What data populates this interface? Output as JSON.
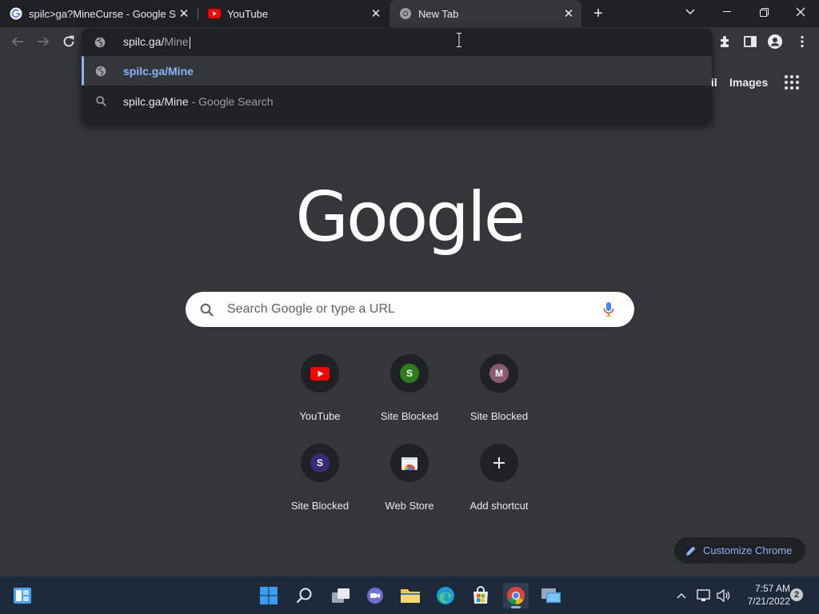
{
  "tabs": [
    {
      "title": "spilc>ga?MineCurse - Google Se",
      "icon": "google-g-icon"
    },
    {
      "title": "YouTube",
      "icon": "youtube-icon"
    },
    {
      "title": "New Tab",
      "icon": "chrome-icon",
      "active": true
    }
  ],
  "omnibox": {
    "typed": "spilc.ga/",
    "autocomplete": "Mine",
    "suggestions": [
      {
        "text": "spilc.ga/Mine",
        "suffix": "",
        "icon": "globe-icon",
        "selected": true
      },
      {
        "text": "spilc.ga/Mine",
        "suffix": " - Google Search",
        "icon": "search-icon",
        "selected": false
      }
    ]
  },
  "header": {
    "gmail_partial": "il",
    "images": "Images"
  },
  "logo": "Google",
  "search": {
    "placeholder": "Search Google or type a URL"
  },
  "shortcuts": [
    {
      "label": "YouTube",
      "icon": "youtube-icon"
    },
    {
      "label": "Site Blocked",
      "letter": "S",
      "color": "#2e7d1a"
    },
    {
      "label": "Site Blocked",
      "letter": "M",
      "color": "#8a5a72"
    },
    {
      "label": "Site Blocked",
      "letter": "S",
      "color": "#3a2a7a"
    },
    {
      "label": "Web Store",
      "icon": "web-store-icon"
    },
    {
      "label": "Add shortcut",
      "icon": "plus-icon"
    }
  ],
  "customize": "Customize Chrome",
  "taskbar": {
    "time": "7:57 AM",
    "date": "7/21/2022",
    "notifications": "2"
  },
  "colors": {
    "accent": "#8ab4f8",
    "background": "#35363a",
    "tabstrip": "#202124"
  }
}
